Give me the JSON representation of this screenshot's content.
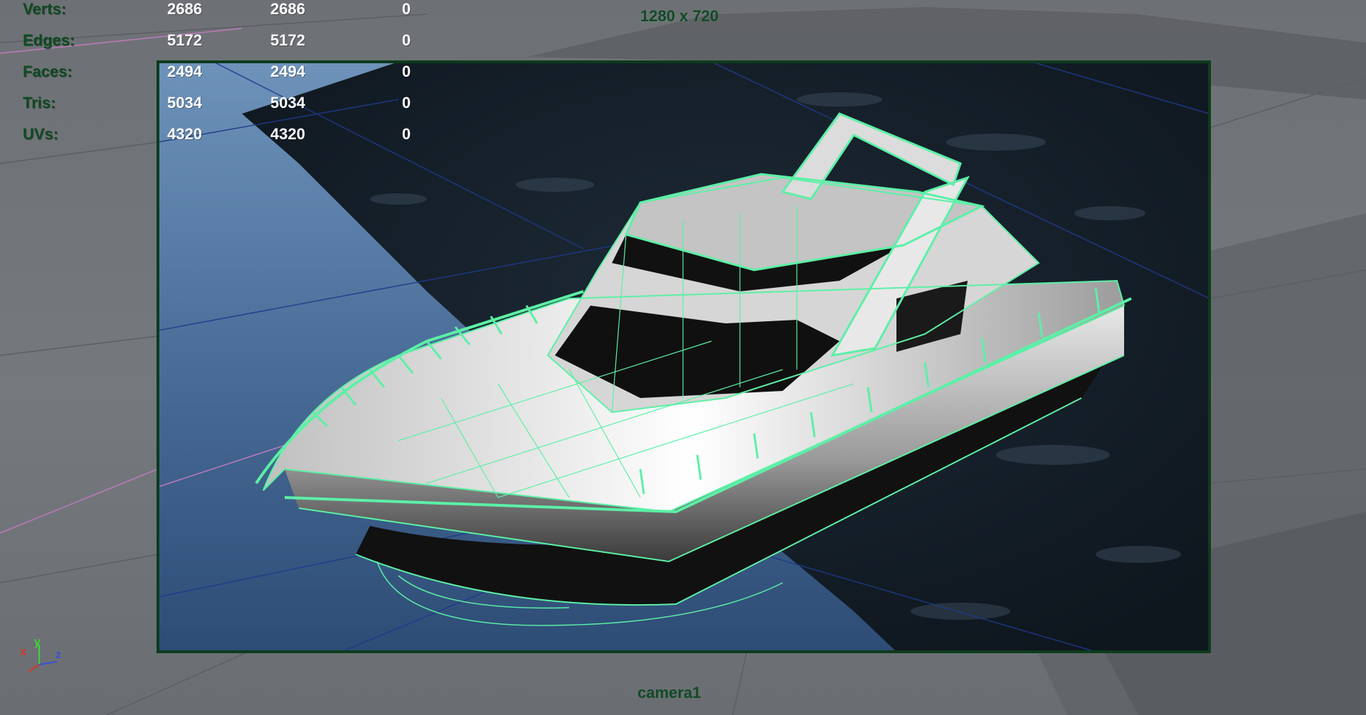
{
  "viewport": {
    "resolution_gate": "1280 x 720",
    "camera_name": "camera1"
  },
  "hud": {
    "rows": [
      {
        "label": "Verts:",
        "selected": "2686",
        "total": "2686",
        "extra": "0"
      },
      {
        "label": "Edges:",
        "selected": "5172",
        "total": "5172",
        "extra": "0"
      },
      {
        "label": "Faces:",
        "selected": "2494",
        "total": "2494",
        "extra": "0"
      },
      {
        "label": "Tris:",
        "selected": "5034",
        "total": "5034",
        "extra": "0"
      },
      {
        "label": "UVs:",
        "selected": "4320",
        "total": "4320",
        "extra": "0"
      }
    ]
  },
  "axis": {
    "x": "x",
    "y": "y",
    "z": "z",
    "x_color": "#d8342a",
    "y_color": "#3fd23f",
    "z_color": "#3a4fd8"
  },
  "colors": {
    "wireframe": "#5cf0a6",
    "gate": "#0d3b1c",
    "hud_label": "#0f4a22"
  }
}
